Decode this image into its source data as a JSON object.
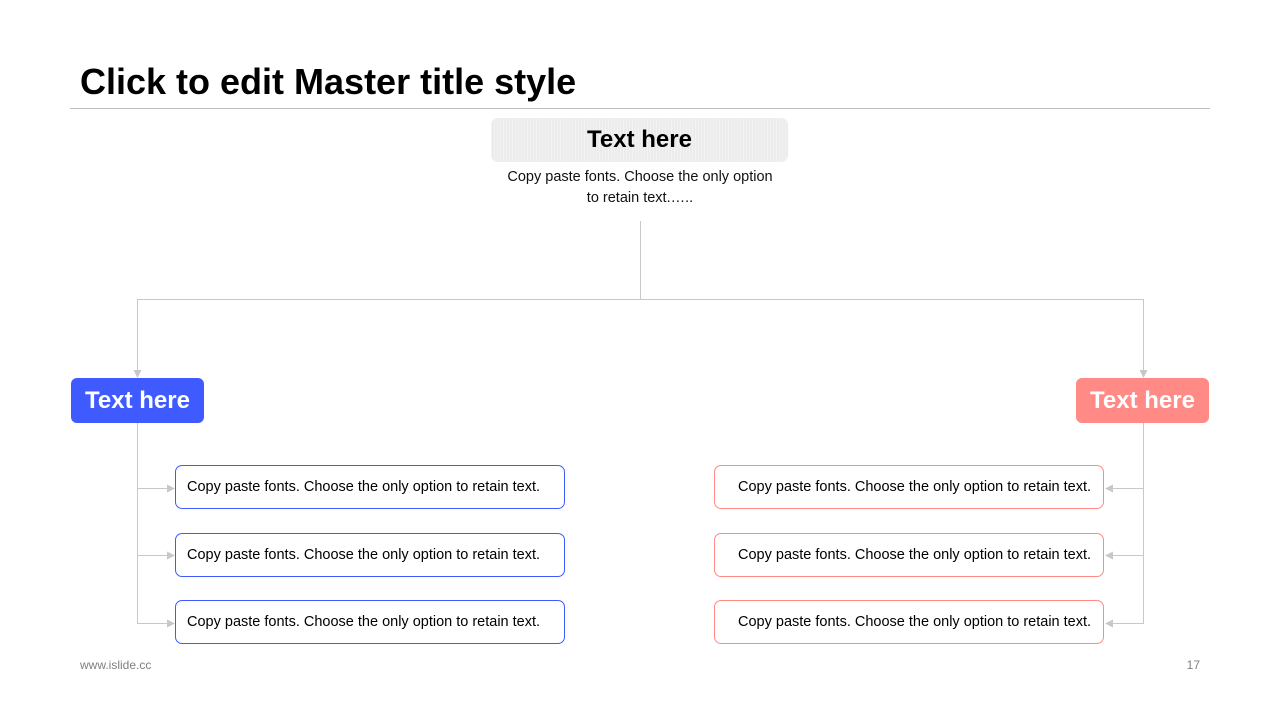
{
  "slide": {
    "title": "Click to edit Master title style",
    "footer_url": "www.islide.cc",
    "page_number": "17"
  },
  "top_node": {
    "label": "Text here",
    "description_line1": "Copy paste fonts. Choose the only option",
    "description_line2": "to retain text.….."
  },
  "left_branch": {
    "label": "Text here",
    "color": "#3f5bff",
    "items": [
      "Copy paste fonts. Choose the only option to retain text.",
      "Copy paste fonts. Choose the only option to retain text.",
      "Copy paste fonts. Choose the only option to retain text."
    ]
  },
  "right_branch": {
    "label": "Text here",
    "color": "#ff8a86",
    "items": [
      "Copy paste fonts. Choose the only option to retain text.",
      "Copy paste fonts. Choose the only option to retain text.",
      "Copy paste fonts. Choose the only option to retain text."
    ]
  },
  "connector_color": "#c8c8c8"
}
